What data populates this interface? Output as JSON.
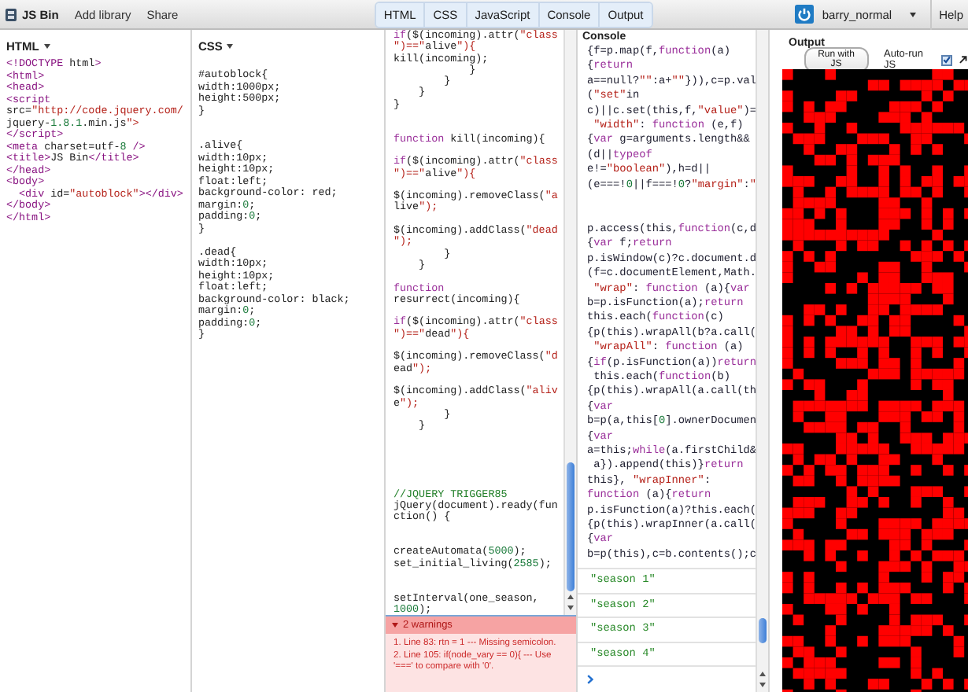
{
  "toolbar": {
    "app_name": "JS Bin",
    "actions": [
      "Add library",
      "Share"
    ],
    "tabs": [
      {
        "label": "HTML",
        "selected": true
      },
      {
        "label": "CSS",
        "selected": true
      },
      {
        "label": "JavaScript",
        "selected": true
      },
      {
        "label": "Console",
        "selected": true
      },
      {
        "label": "Output",
        "selected": true
      }
    ],
    "user": "barry_normal",
    "help": "Help"
  },
  "html_panel": {
    "title": "HTML",
    "code": "<!DOCTYPE html>\n<html>\n<head>\n<script\nsrc=\"http://code.jquery.com/\njquery-1.8.1.min.js\">\n</script>\n<meta charset=utf-8 />\n<title>JS Bin</title>\n</head>\n<body>\n  <div id=\"autoblock\"></div>\n</body>\n</html>"
  },
  "css_panel": {
    "title": "CSS",
    "code": "#autoblock{\nwidth:1000px;\nheight:500px;\n}\n\n\n.alive{\nwidth:10px;\nheight:10px;\nfloat:left;\nbackground-color: red;\nmargin:0;\npadding:0;\n}\n\n.dead{\nwidth:10px;\nheight:10px;\nfloat:left;\nbackground-color: black;\nmargin:0;\npadding:0;\n}"
  },
  "js_panel": {
    "code": "if($(incoming).attr(\"class\n\")==\"alive\"){\nkill(incoming);\n            }\n        }\n    }\n}\n\n\nfunction kill(incoming){\n\nif($(incoming).attr(\"class\n\")==\"alive\"){\n\n$(incoming).removeClass(\"a\nlive\");\n\n$(incoming).addClass(\"dead\n\");\n        }\n    }\n\nfunction\nresurrect(incoming){\n\nif($(incoming).attr(\"class\n\")==\"dead\"){\n\n$(incoming).removeClass(\"d\nead\");\n\n$(incoming).addClass(\"aliv\ne\");\n        }\n    }\n\n\n\n\n\n//JQUERY TRIGGER85\njQuery(document).ready(fun\nction() {\n\n\ncreateAutomata(5000);\nset_initial_living(2585);\n\n\nsetInterval(one_season,\n1000);",
    "warnings": {
      "summary": "2 warnings",
      "expanded": true,
      "items": [
        "1. Line 83: rtn = 1 --- Missing semicolon.",
        "2. Line 105: if(node_vary == 0){ --- Use '===' to compare with '0'."
      ]
    }
  },
  "console_panel": {
    "title": "Console",
    "output": "{f=p.map(f,function(a)\n{return\na==null?\"\":a+\"\"})),c=p.val\n(\"set\"in\nc)||c.set(this,f,\"value\")=\n \"width\": function (e,f)\n{var g=arguments.length&&\n(d||typeof\ne!=\"boolean\"),h=d||\n(e===!0||f===!0?\"margin\":\"\n\n\np.access(this,function(c,d\n{var f;return\np.isWindow(c)?c.document.d\n(f=c.documentElement,Math.\n \"wrap\": function (a){var\nb=p.isFunction(a);return\nthis.each(function(c)\n{p(this).wrapAll(b?a.call(\n \"wrapAll\": function (a)\n{if(p.isFunction(a))return\n this.each(function(b)\n{p(this).wrapAll(a.call(th\n{var\nb=p(a,this[0].ownerDocumen\n{var\na=this;while(a.firstChild&\n a}).append(this)}return\nthis}, \"wrapInner\":\nfunction (a){return\np.isFunction(a)?this.each(\n{p(this).wrapInner(a.call(\n{var\nb=p(this),c=b.contents();c",
    "logs": [
      "\"season 1\"",
      "\"season 2\"",
      "\"season 3\"",
      "\"season 4\""
    ]
  },
  "output_panel": {
    "title": "Output",
    "run_button": "Run with JS",
    "auto_run": {
      "label": "Auto-run JS",
      "checked": true
    }
  }
}
